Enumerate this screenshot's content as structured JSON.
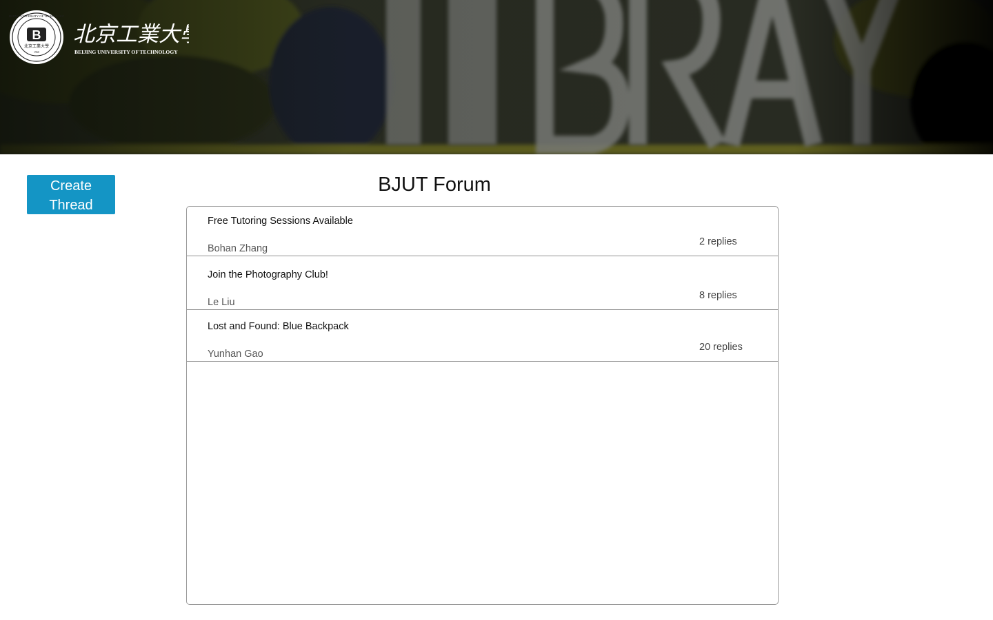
{
  "header": {
    "logo_name_cn": "北京工業大學",
    "logo_name_en": "BEIJING UNIVERSITY OF TECHNOLOGY",
    "seal_ring_text": "BEIJING UNIVERSITY OF TECHNOLOGY",
    "seal_cn": "北京工業大學",
    "seal_year": "1960",
    "banner_photo_text": "LIBRARY"
  },
  "sidebar": {
    "create_button_label": "Create Thread"
  },
  "forum": {
    "title": "BJUT Forum",
    "threads": [
      {
        "title": "Free Tutoring Sessions Available",
        "author": "Bohan Zhang",
        "replies": "2 replies"
      },
      {
        "title": "Join the Photography Club!",
        "author": "Le Liu",
        "replies": "8 replies"
      },
      {
        "title": "Lost and Found: Blue Backpack",
        "author": "Yunhan Gao",
        "replies": "20 replies"
      }
    ]
  },
  "colors": {
    "accent": "#1495c5",
    "border": "#9a9a9a"
  }
}
